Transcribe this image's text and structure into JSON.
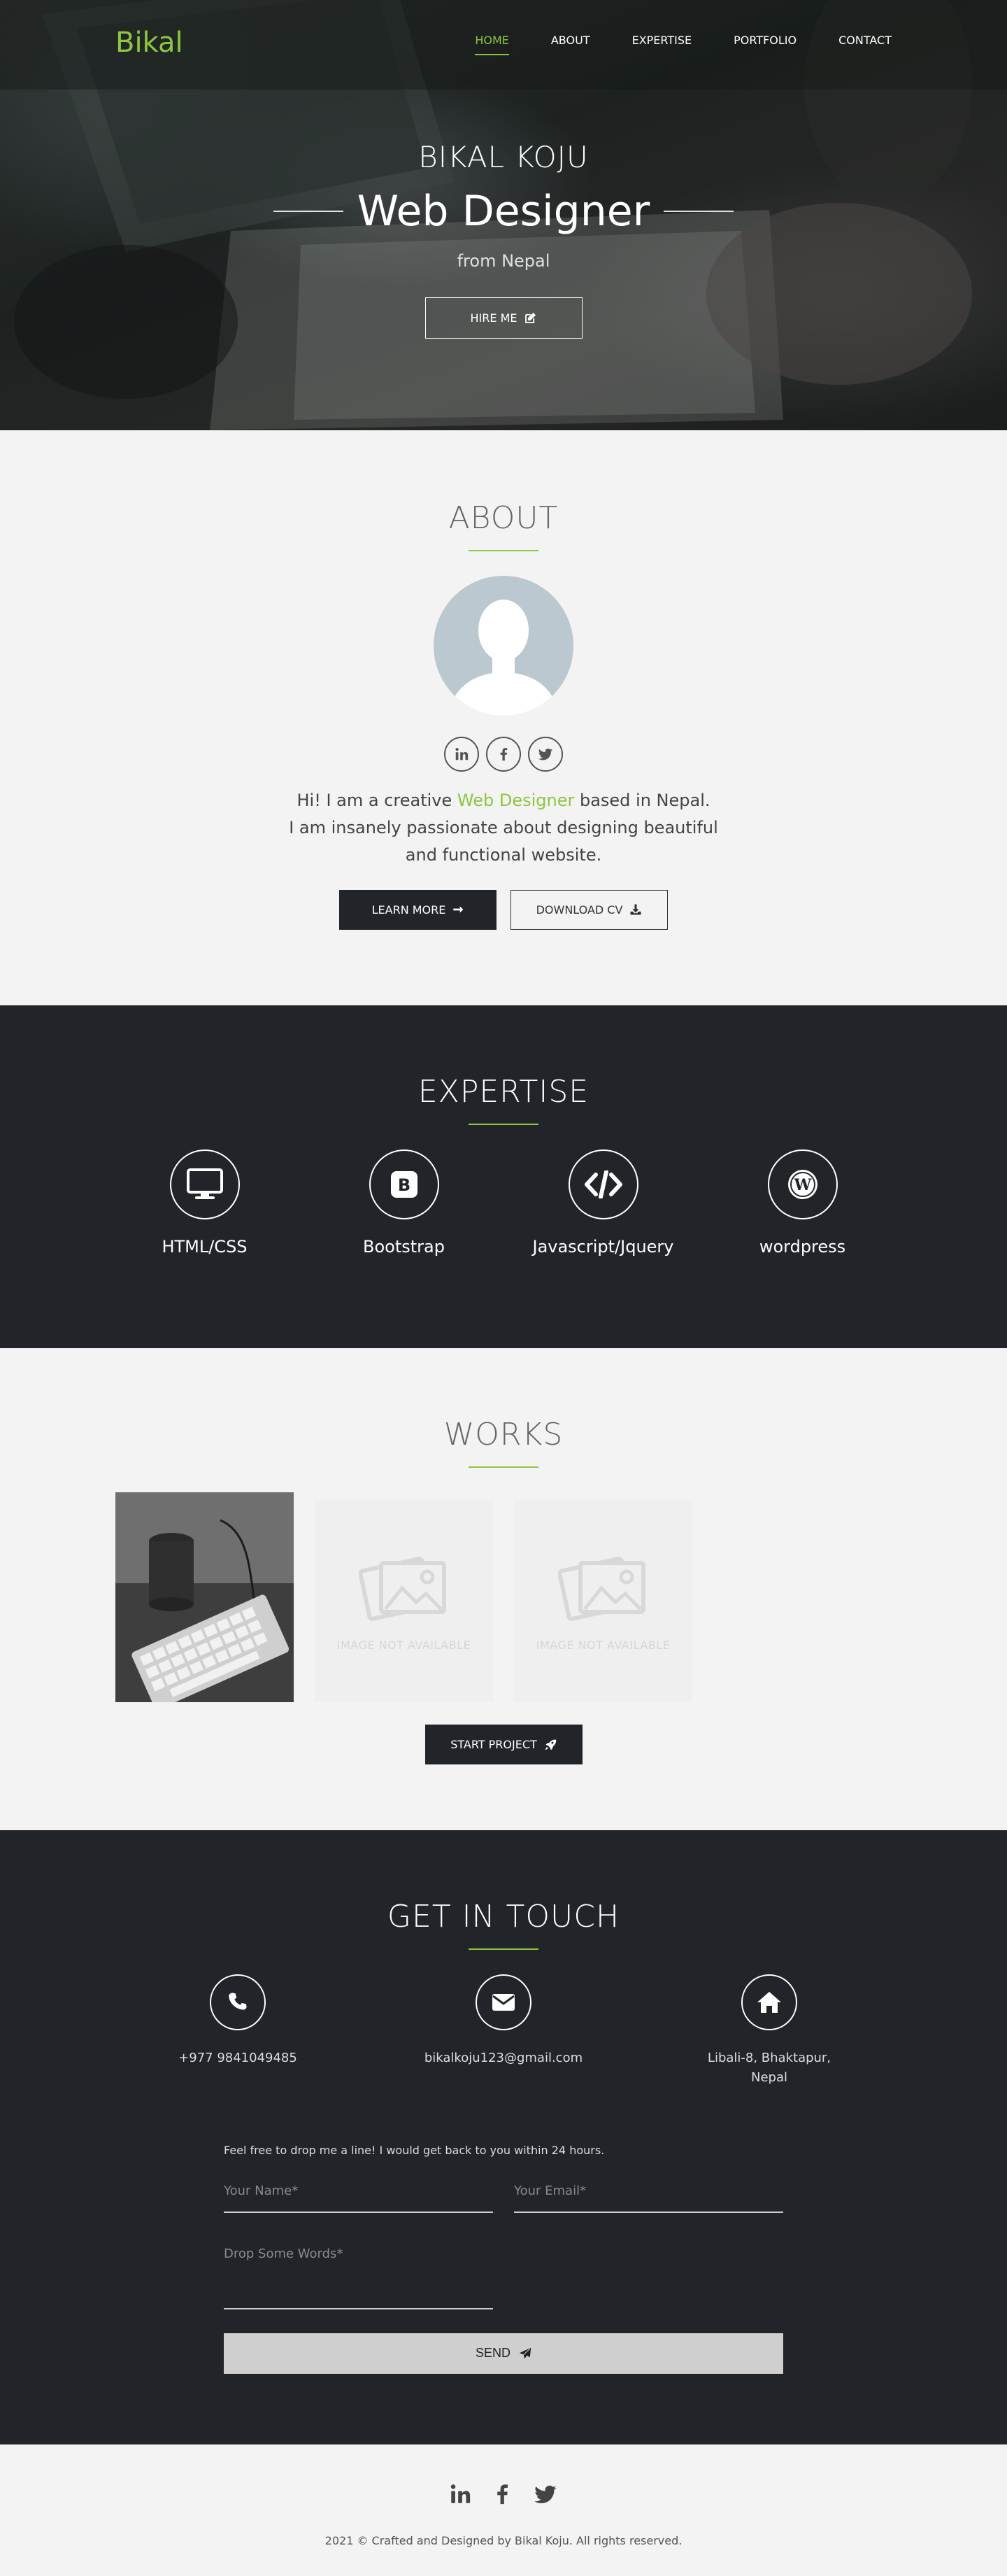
{
  "brand": {
    "logo": "Bikal",
    "accent": "#8dc63f",
    "dark": "#212529"
  },
  "nav": {
    "items": [
      "HOME",
      "ABOUT",
      "EXPERTISE",
      "PORTFOLIO",
      "CONTACT"
    ],
    "active": "HOME"
  },
  "hero": {
    "name": "BIKAL KOJU",
    "role": "Web Designer",
    "from": "from Nepal",
    "cta": "HIRE ME",
    "cta_icon": "edit-icon"
  },
  "about": {
    "title": "ABOUT",
    "line1_pre": "Hi! I am a creative ",
    "line1_hl": "Web Designer",
    "line1_post": " based in Nepal.",
    "line2": "I am insanely passionate about designing beautiful",
    "line3": "and functional website.",
    "learn_more": "LEARN MORE",
    "download_cv": "DOWNLOAD CV",
    "socials": [
      "linkedin-icon",
      "facebook-icon",
      "twitter-icon"
    ]
  },
  "expertise": {
    "title": "EXPERTISE",
    "items": [
      {
        "label": "HTML/CSS",
        "icon": "monitor-icon"
      },
      {
        "label": "Bootstrap",
        "icon": "bootstrap-icon"
      },
      {
        "label": "Javascript/Jquery",
        "icon": "code-icon"
      },
      {
        "label": "wordpress",
        "icon": "wordpress-icon"
      }
    ]
  },
  "works": {
    "title": "WORKS",
    "na_text": "IMAGE NOT AVAILABLE",
    "cta": "START PROJECT"
  },
  "contact": {
    "title": "GET IN TOUCH",
    "phone": "+977 9841049485",
    "email": "bikalkoju123@gmail.com",
    "address_line1": "Libali-8, Bhaktapur,",
    "address_line2": "Nepal",
    "note": "Feel free to drop me a line! I would get back to you within 24 hours.",
    "name_placeholder": "Your Name*",
    "email_placeholder": "Your Email*",
    "message_placeholder": "Drop Some Words*",
    "send": "SEND"
  },
  "footer": {
    "copyright": "2021 © Crafted and Designed by Bikal Koju. All rights reserved.",
    "socials": [
      "linkedin-icon",
      "facebook-icon",
      "twitter-icon"
    ]
  }
}
